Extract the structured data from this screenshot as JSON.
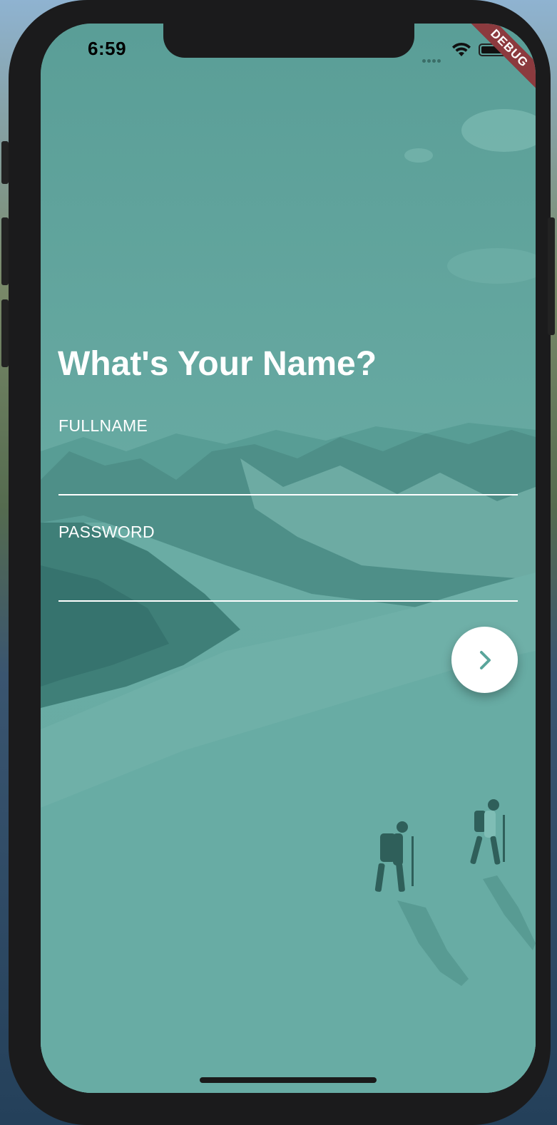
{
  "status_bar": {
    "time": "6:59",
    "debug_banner": "DEBUG"
  },
  "form": {
    "title": "What's Your Name?",
    "fullname_label": "FULLNAME",
    "fullname_value": "",
    "password_label": "PASSWORD",
    "password_value": ""
  },
  "icons": {
    "next": "chevron-right-icon",
    "wifi": "wifi-icon",
    "battery": "battery-icon",
    "signal": "signal-icon"
  },
  "colors": {
    "overlay_teal": "#63aba1",
    "accent_teal": "#5aa59b",
    "text": "#ffffff",
    "debug_ribbon": "#8c3a3e"
  }
}
